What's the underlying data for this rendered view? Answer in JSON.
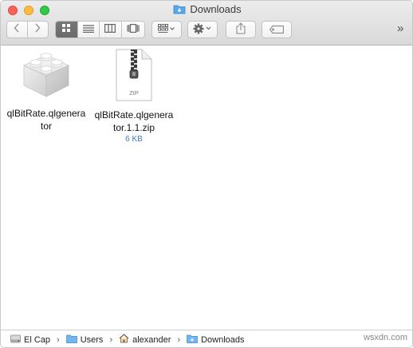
{
  "window": {
    "title": "Downloads"
  },
  "toolbar": {
    "back_icon": "chevron-left-icon",
    "forward_icon": "chevron-right-icon",
    "view_modes": [
      "icon-view",
      "list-view",
      "column-view",
      "cover-flow-view"
    ],
    "active_view": "icon-view",
    "overflow_label": "»"
  },
  "files": [
    {
      "name": "qlBitRate.qlgenerator",
      "size": "",
      "icon": "plugin-bundle-icon"
    },
    {
      "name": "qlBitRate.qlgenerator.1.1.zip",
      "size": "6 KB",
      "icon": "zip-archive-icon",
      "badge": "ZIP"
    }
  ],
  "pathbar": {
    "items": [
      {
        "label": "El Cap",
        "icon": "hard-drive-icon"
      },
      {
        "label": "Users",
        "icon": "folder-icon"
      },
      {
        "label": "alexander",
        "icon": "home-icon"
      },
      {
        "label": "Downloads",
        "icon": "downloads-folder-icon"
      }
    ]
  },
  "watermark": "wsxdn.com",
  "colors": {
    "accent": "#3f78c2",
    "close": "#fc605b",
    "minimize": "#fdbc40",
    "maximize": "#34c84a"
  }
}
